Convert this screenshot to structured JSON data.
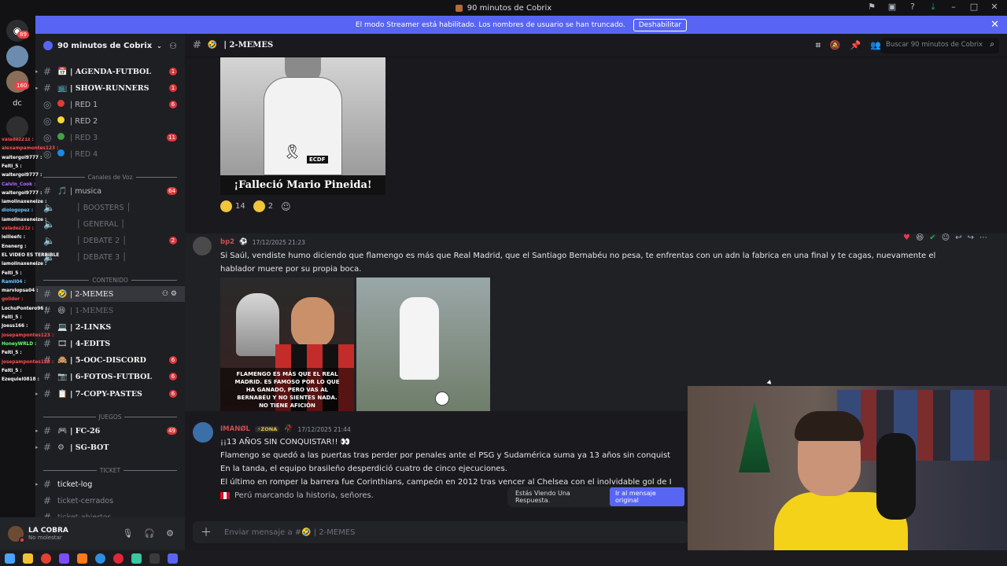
{
  "window": {
    "title": "90 minutos de Cobrix"
  },
  "banner": {
    "text": "El modo Streamer está habilitado. Los nombres de usuario se han truncado.",
    "button": "Deshabilitar"
  },
  "guilds": {
    "badges": [
      "89",
      "160"
    ],
    "dm_label": "dc"
  },
  "server": {
    "name": "90 minutos de Cobrix"
  },
  "channels": [
    {
      "name": "| AGENDA-FUTBOL",
      "badge": "1"
    },
    {
      "name": "| SHOW-RUNNERS",
      "badge": "1"
    },
    {
      "name": "| RED 1",
      "badge": "6"
    },
    {
      "name": "| RED 2",
      "badge": ""
    },
    {
      "name": "| RED 3",
      "badge": "11"
    },
    {
      "name": "| RED 4",
      "badge": ""
    },
    {
      "name": "| musica",
      "badge": "64"
    },
    {
      "name": "│ BOOSTERS │",
      "badge": ""
    },
    {
      "name": "│ GENERAL │",
      "badge": ""
    },
    {
      "name": "│ DEBATE 2 │",
      "badge": "2"
    },
    {
      "name": "│ DEBATE 3 │",
      "badge": ""
    },
    {
      "name": "| 2-MEMES",
      "badge": ""
    },
    {
      "name": "| 1-MEMES",
      "badge": ""
    },
    {
      "name": "| 2-LINKS",
      "badge": ""
    },
    {
      "name": "| 4-EDITS",
      "badge": ""
    },
    {
      "name": "| 5-OOC-DISCORD",
      "badge": "6"
    },
    {
      "name": "| 6-FOTOS-FUTBOL",
      "badge": "6"
    },
    {
      "name": "| 7-COPY-PASTES",
      "badge": "6"
    },
    {
      "name": "| FC-26",
      "badge": "49"
    },
    {
      "name": "| SG-BOT",
      "badge": ""
    },
    {
      "name": "ticket-log",
      "badge": ""
    },
    {
      "name": "ticket-cerrados",
      "badge": ""
    },
    {
      "name": "ticket-abiertos",
      "badge": ""
    }
  ],
  "categories": [
    "Canales de Voz",
    "CONTENIDO",
    "JUEGOS",
    "TICKET"
  ],
  "chat_overlay": [
    {
      "text": "valadez21z :",
      "color": "#ff4d4d"
    },
    {
      "text": "alexampamontes123 :",
      "color": "#ff4d4d"
    },
    {
      "text": "waltergol9777 :",
      "color": "#ffffff"
    },
    {
      "text": "Felti_5 :",
      "color": "#ffffff"
    },
    {
      "text": "waltergol9777 :",
      "color": "#ffffff"
    },
    {
      "text": "Calvin_Cook :",
      "color": "#b06cff"
    },
    {
      "text": "waltergol9777 :",
      "color": "#ffffff"
    },
    {
      "text": "lamolinaxeneize :",
      "color": "#ffffff"
    },
    {
      "text": "diologopez :",
      "color": "#6ec6ff"
    },
    {
      "text": "lamolinaxeneize :",
      "color": "#ffffff"
    },
    {
      "text": "valadez21z :",
      "color": "#ff4d4d"
    },
    {
      "text": "leilleefc :",
      "color": "#ffffff"
    },
    {
      "text": "Enenerg :",
      "color": "#ffffff"
    },
    {
      "text": "EL VIDEO ES TERRIBLE",
      "color": "#ffffff"
    },
    {
      "text": "lamolinaxeneize :",
      "color": "#ffffff"
    },
    {
      "text": "Felti_5 :",
      "color": "#ffffff"
    },
    {
      "text": "Ramil04 :",
      "color": "#6ec6ff"
    },
    {
      "text": "marvlopsa04 :",
      "color": "#ffffff"
    },
    {
      "text": "golidor :",
      "color": "#ff4d4d"
    },
    {
      "text": "LochuPontero96 :",
      "color": "#ffffff"
    },
    {
      "text": "Felti_5 :",
      "color": "#ffffff"
    },
    {
      "text": "Joess166 :",
      "color": "#ffffff"
    },
    {
      "text": "josepampontes123 :",
      "color": "#ff4d4d"
    },
    {
      "text": "HoneyWRLD :",
      "color": "#6cff6c"
    },
    {
      "text": "Felti_5 :",
      "color": "#ffffff"
    },
    {
      "text": "josepampontes123 :",
      "color": "#ff4d4d"
    },
    {
      "text": "Felti_5 :",
      "color": "#ffffff"
    },
    {
      "text": "Ezequiel0818 :",
      "color": "#ffffff"
    }
  ],
  "header": {
    "channel": "| 2-MEMES",
    "search_placeholder": "Buscar 90 minutos de Cobrix"
  },
  "messages": {
    "first_caption": "¡Falleció Mario Pineida!",
    "logo_text": "ECDF",
    "reactions": [
      {
        "count": "14"
      },
      {
        "count": "2"
      }
    ],
    "m1": {
      "author": "bp2",
      "time": "17/12/2025 21:23",
      "text1": "Si Saúl, vendiste humo diciendo que flamengo es más que Real Madrid, que el Santiago Bernabéu no pesa, te enfrentas con un adn la fabrica en una final y te cagas, nuevamente el",
      "text2": "hablador muere por su propia boca.",
      "att_text": "FLAMENGO ES MÁS QUE EL REAL MADRID. ES FAMOSO POR LO QUE HA GANADO, PERO VAS AL BERNABÉU Y NO SIENTES NADA. NO TIENE AFICIÓN"
    },
    "m2": {
      "author": "IMANØL",
      "tag": "ZONA",
      "time": "17/12/2025 21:44",
      "l1": "¡¡13 AÑOS SIN CONQUISTAR!! 👀",
      "l2": "Flamengo se quedó a las puertas tras perder por penales ante el PSG y Sudamérica suma ya 13 años sin conquist",
      "l3": "En la tanda, el equipo brasileño desperdició cuatro de cinco ejecuciones.",
      "l4": "El último en romper la barrera fue Corinthians, campeón en 2012 tras vencer al Chelsea con el inolvidable gol de I",
      "l5": "Perú marcando la historia, señores."
    }
  },
  "reply": {
    "text": "Estás Viendo Una Respuesta.",
    "button": "Ir al mensaje original"
  },
  "composer": {
    "placeholder": "Enviar mensaje a #🤣 | 2-MEMES"
  },
  "user": {
    "name": "LA COBRA",
    "status": "No molestar"
  },
  "colors": {
    "accent": "#5865f2",
    "badge": "#da373c",
    "background": "#1a1a1e"
  }
}
